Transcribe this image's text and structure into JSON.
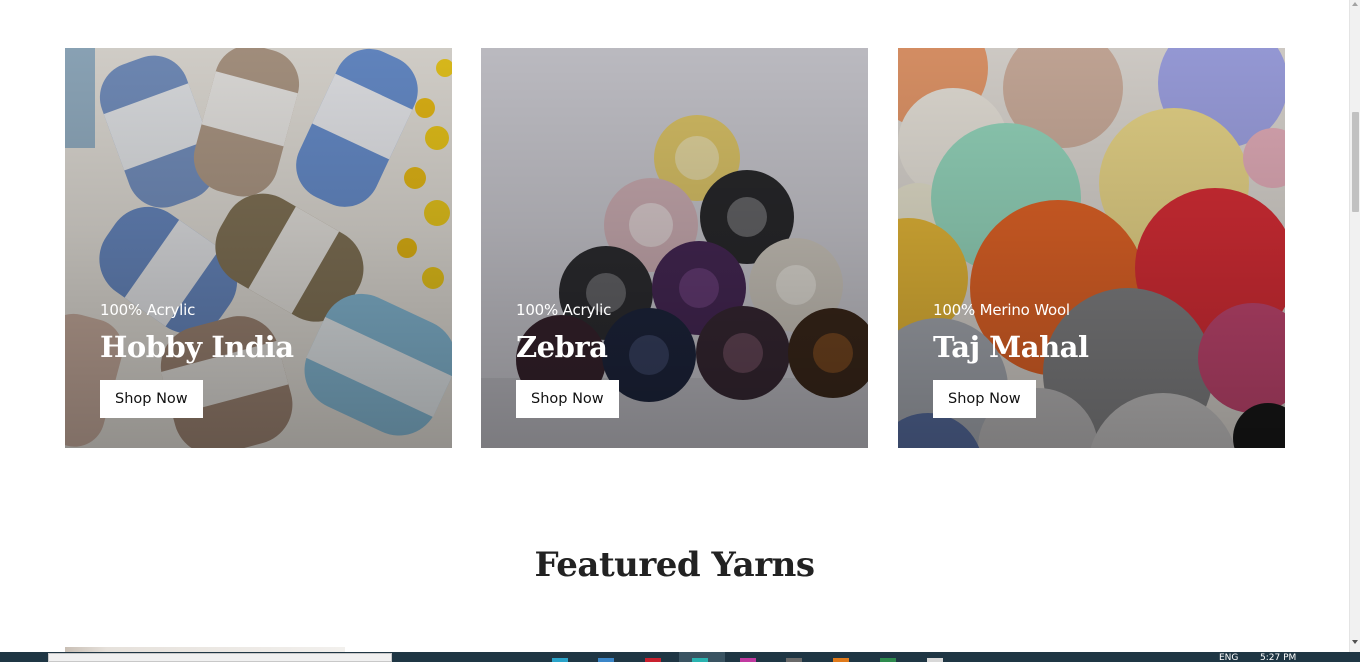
{
  "cards": [
    {
      "subtitle": "100% Acrylic",
      "title": "Hobby India",
      "button": "Shop Now"
    },
    {
      "subtitle": "100% Acrylic",
      "title": "Zebra",
      "button": "Shop Now"
    },
    {
      "subtitle": "100% Merino Wool",
      "title": "Taj Mahal",
      "button": "Shop Now"
    }
  ],
  "section_heading": "Featured Yarns",
  "taskbar": {
    "language": "ENG",
    "time": "5:27 PM"
  }
}
